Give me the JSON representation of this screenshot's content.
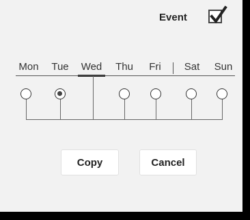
{
  "event": {
    "label": "Event",
    "checked": true
  },
  "days": [
    "Mon",
    "Tue",
    "Wed",
    "Thu",
    "Fri",
    "Sat",
    "Sun"
  ],
  "selected_day": "Wed",
  "radios": [
    {
      "day": "Mon",
      "checked": false
    },
    {
      "day": "Tue",
      "checked": true
    },
    {
      "day": "Thu",
      "checked": false
    },
    {
      "day": "Fri",
      "checked": false
    },
    {
      "day": "Sat",
      "checked": false
    },
    {
      "day": "Sun",
      "checked": false
    }
  ],
  "buttons": {
    "copy": "Copy",
    "cancel": "Cancel"
  }
}
